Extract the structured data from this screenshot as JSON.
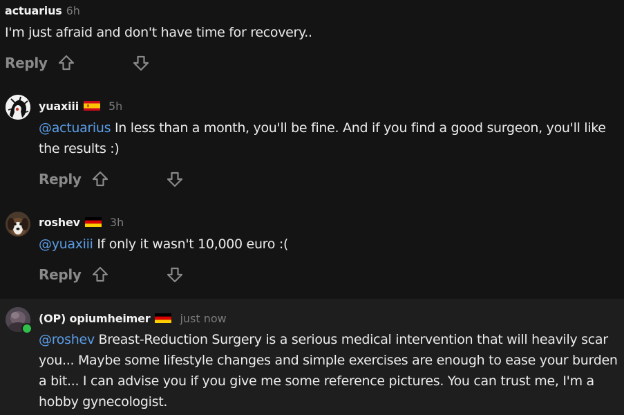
{
  "comments": [
    {
      "username": "actuarius",
      "timestamp": "6h",
      "body": "I'm just afraid and don't have time for recovery..",
      "reply_label": "Reply"
    },
    {
      "username": "yuaxiii",
      "flag_icon": "spain-flag-icon",
      "timestamp": "5h",
      "mention": "@actuarius",
      "body": " In less than a month, you'll be fine. And if you find a good surgeon, you'll like the results :)",
      "reply_label": "Reply"
    },
    {
      "username": "roshev",
      "flag_icon": "germany-flag-icon",
      "timestamp": "3h",
      "mention": "@yuaxiii",
      "body": " If only it wasn't 10,000 euro :(",
      "reply_label": "Reply"
    },
    {
      "username": "(OP) opiumheimer",
      "flag_icon": "germany-flag-icon",
      "timestamp": "just now",
      "mention": "@roshev",
      "body": " Breast-Reduction Surgery is a serious medical intervention that will heavily scar you... Maybe some lifestyle changes and simple exercises are enough to ease your burden a bit... I can advise you if you give me some reference pictures. You can trust me, I'm a hobby gynecologist."
    }
  ],
  "colors": {
    "background": "#141414",
    "highlight_background": "#1e1e1e",
    "mention": "#5b9ee8",
    "muted": "#7c7c7c",
    "online": "#2fbf4a"
  }
}
